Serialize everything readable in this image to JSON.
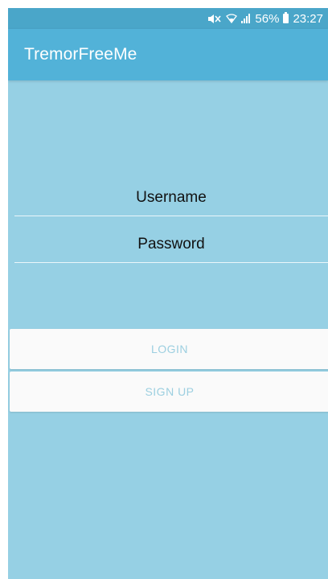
{
  "status_bar": {
    "mute_icon": "mute-icon",
    "wifi_icon": "wifi-icon",
    "signal_icon": "signal-icon",
    "battery_percent": "56%",
    "battery_icon": "battery-icon",
    "time": "23:27"
  },
  "app_bar": {
    "title": "TremorFreeMe",
    "color": "#52b2d8"
  },
  "form": {
    "username_placeholder": "Username",
    "password_placeholder": "Password",
    "background_color": "#96d0e4"
  },
  "actions": {
    "login_label": "LOGIN",
    "signup_label": "SIGN UP"
  }
}
